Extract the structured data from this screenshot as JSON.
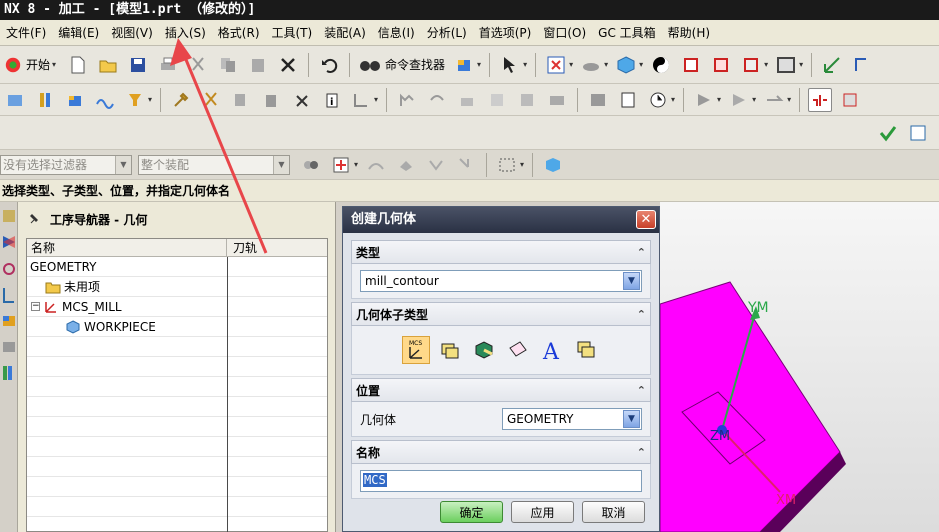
{
  "window": {
    "title": "NX 8 - 加工 - [模型1.prt （修改的）]"
  },
  "menu": [
    "文件(F)",
    "编辑(E)",
    "视图(V)",
    "插入(S)",
    "格式(R)",
    "工具(T)",
    "装配(A)",
    "信息(I)",
    "分析(L)",
    "首选项(P)",
    "窗口(O)",
    "GC 工具箱",
    "帮助(H)"
  ],
  "toolbar": {
    "start_label": "开始",
    "command_finder_label": "命令查找器",
    "filter_placeholder": "没有选择过滤器",
    "assembly_scope": "整个装配"
  },
  "prompt": "选择类型、子类型、位置，并指定几何体名",
  "navigator": {
    "title": "工序导航器 - 几何",
    "columns": [
      "名称",
      "刀轨"
    ],
    "rows": [
      {
        "name": "GEOMETRY",
        "icon": "none"
      },
      {
        "name": "未用项",
        "icon": "folder-icon"
      },
      {
        "name": "MCS_MILL",
        "icon": "mcs-icon"
      },
      {
        "name": "WORKPIECE",
        "icon": "workpiece-icon"
      }
    ]
  },
  "dialog": {
    "title": "创建几何体",
    "sections": {
      "type": {
        "label": "类型",
        "value": "mill_contour"
      },
      "subtype": {
        "label": "几何体子类型"
      },
      "position": {
        "label": "位置",
        "field_label": "几何体",
        "value": "GEOMETRY"
      },
      "name": {
        "label": "名称",
        "value": "MCS"
      }
    },
    "buttons": {
      "ok": "确定",
      "apply": "应用",
      "cancel": "取消"
    }
  },
  "viewport": {
    "axis_y": "YM",
    "axis_z": "ZM",
    "axis_x": "XM",
    "part_color": "#ff00ff",
    "axis_color": "#2aa84a"
  },
  "colors": {
    "annotation_arrow": "#e8464a"
  }
}
